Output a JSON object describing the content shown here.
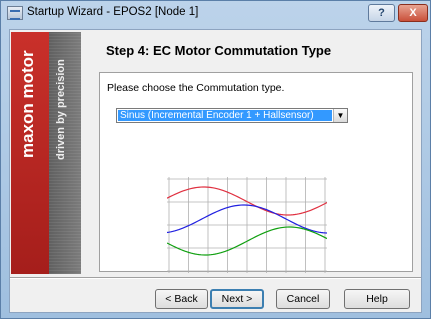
{
  "window": {
    "title": "Startup Wizard - EPOS2 [Node 1]",
    "help_label": "?",
    "close_label": "X"
  },
  "banner": {
    "brand": "maxon motor",
    "tagline": "driven by precision"
  },
  "step_title": "Step 4: EC Motor Commutation Type",
  "instruction": "Please choose the Commutation type.",
  "commutation_select": {
    "selected": "Sinus (Incremental Encoder 1 + Hallsensor)",
    "arrow": "▼"
  },
  "diagram": {
    "icon": "sinusoidal-commutation-waveform",
    "colors": {
      "phase1": "#e03040",
      "phase2": "#2020e0",
      "phase3": "#10a010",
      "grid": "#b0b0b0"
    }
  },
  "buttons": {
    "back": "< Back",
    "next": "Next >",
    "cancel": "Cancel",
    "help": "Help"
  }
}
